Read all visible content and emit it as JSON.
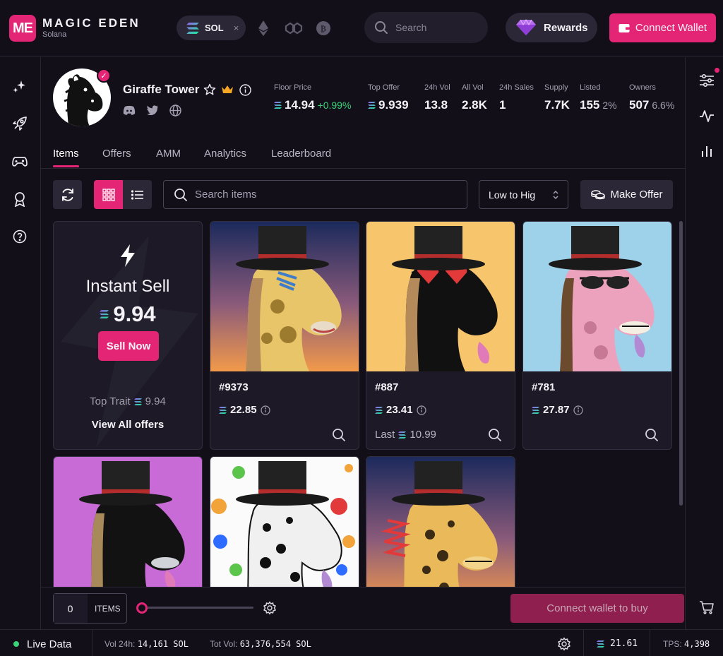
{
  "brand": {
    "name": "MAGIC EDEN",
    "sub": "Solana",
    "logo": "ME"
  },
  "chains": {
    "active": "SOL",
    "close": "×",
    "icons": [
      "ethereum-icon",
      "polygon-icon",
      "bitcoin-icon"
    ]
  },
  "search": {
    "placeholder": "Search"
  },
  "rewards": {
    "label": "Rewards"
  },
  "connect": {
    "label": "Connect Wallet"
  },
  "collection": {
    "name": "Giraffe Tower",
    "stats": [
      {
        "label": "Floor Price",
        "value": "14.94",
        "extra": "+0.99%",
        "sol": true
      },
      {
        "label": "Top Offer",
        "value": "9.939",
        "sol": true
      },
      {
        "label": "24h Vol",
        "value": "13.8"
      },
      {
        "label": "All Vol",
        "value": "2.8K"
      },
      {
        "label": "24h Sales",
        "value": "1"
      },
      {
        "label": "Supply",
        "value": "7.7K"
      },
      {
        "label": "Listed",
        "value": "155",
        "extra": "2%"
      },
      {
        "label": "Owners",
        "value": "507",
        "extra": "6.6%"
      }
    ]
  },
  "tabs": [
    "Items",
    "Offers",
    "AMM",
    "Analytics",
    "Leaderboard"
  ],
  "toolbar": {
    "search_placeholder": "Search items",
    "sort": "Low to Hig",
    "make_offer": "Make Offer"
  },
  "instant_sell": {
    "title": "Instant Sell",
    "price": "9.94",
    "button": "Sell Now",
    "top_trait_label": "Top Trait",
    "top_trait_value": "9.94",
    "view_offers": "View All offers"
  },
  "items": [
    {
      "name": "#9373",
      "price": "22.85",
      "last": ""
    },
    {
      "name": "#887",
      "price": "23.41",
      "last_label": "Last",
      "last": "10.99"
    },
    {
      "name": "#781",
      "price": "27.87",
      "last": ""
    }
  ],
  "buy_bar": {
    "count": "0",
    "items_label": "ITEMS",
    "buy_label": "Connect wallet to buy"
  },
  "status": {
    "live": "Live Data",
    "vol24_label": "Vol 24h:",
    "vol24": "14,161 SOL",
    "totvol_label": "Tot Vol:",
    "totvol": "63,376,554 SOL",
    "sol_price": "21.61",
    "tps_label": "TPS:",
    "tps": "4,398"
  },
  "colors": {
    "accent": "#e42575",
    "bg": "#120f19",
    "positive": "#39d37a"
  }
}
